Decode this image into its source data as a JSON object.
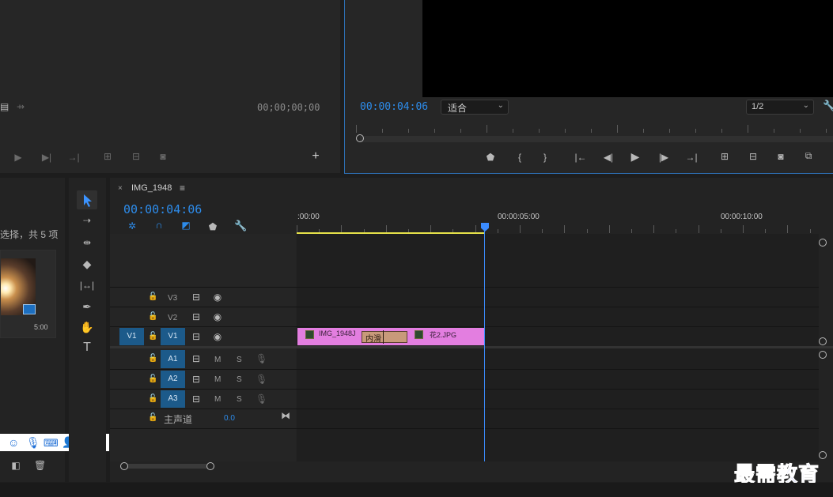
{
  "source_monitor": {
    "timecode": "00;00;00;00"
  },
  "program_monitor": {
    "timecode": "00:00:04:06",
    "zoom_select": "适合",
    "resolution_select": "1/2"
  },
  "project_panel": {
    "items_summary": "选择，共 5 项",
    "thumb_duration": "5:00"
  },
  "sequence": {
    "tab_name": "IMG_1948",
    "timecode": "00:00:04:06",
    "ruler_labels": [
      ":00:00",
      "00:00:05:00",
      "00:00:10:00"
    ],
    "playhead_fraction": 0.4167,
    "tracks": {
      "v3": "V3",
      "v2": "V2",
      "v1": "V1",
      "v1_source": "V1",
      "a1": "A1",
      "a2": "A2",
      "a3": "A3",
      "mute": "M",
      "solo": "S",
      "master_label": "主声道",
      "master_value": "0.0"
    },
    "clips": {
      "clip1_name": "IMG_1948J",
      "transition_label": "内滑",
      "clip2_name": "花2.JPG"
    }
  },
  "watermark": "最需教育",
  "colors": {
    "accent_blue": "#2d8ceb",
    "clip_pink": "#e37ee0",
    "transition": "#c89a7a",
    "work_area": "#e6e24a"
  }
}
